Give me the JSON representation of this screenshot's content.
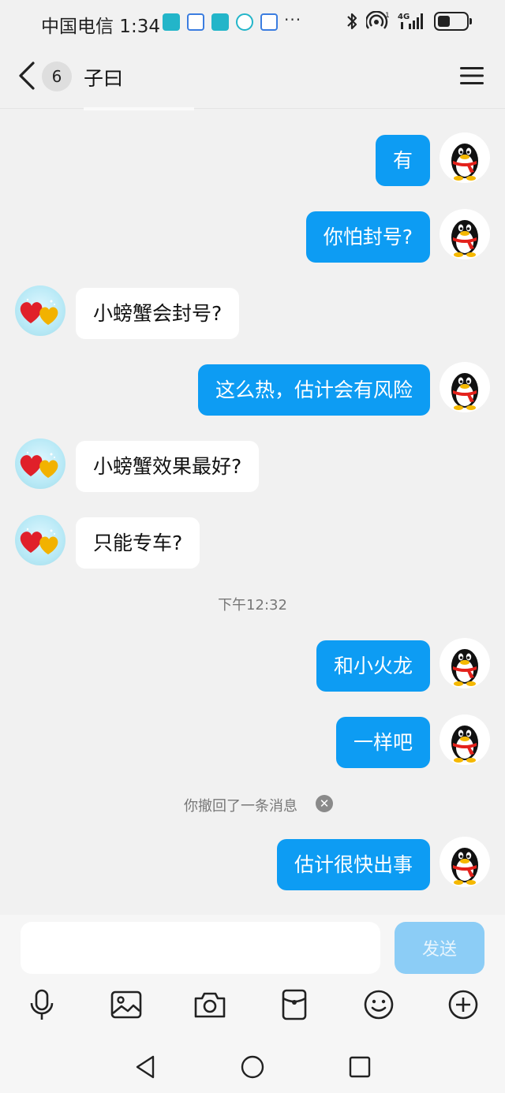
{
  "status_bar": {
    "carrier_time": "中国电信 1:34",
    "more": "···",
    "network": "4G",
    "battery_level": 0.45,
    "icons": [
      "huawei-app-icon",
      "baidu-app-icon",
      "huawei-app-icon",
      "shield-check-icon",
      "baidu-app-icon",
      "bluetooth-icon",
      "hotspot-icon",
      "signal-icon",
      "battery-icon"
    ]
  },
  "header": {
    "back_icon": "chevron-left-icon",
    "unread_count": "6",
    "title": "子曰",
    "menu_icon": "hamburger-menu-icon"
  },
  "messages": [
    {
      "side": "out",
      "text": "有"
    },
    {
      "side": "out",
      "text": "你怕封号?"
    },
    {
      "side": "in",
      "text": "小螃蟹会封号?"
    },
    {
      "side": "out",
      "text": "这么热，估计会有风险"
    },
    {
      "side": "in",
      "text": "小螃蟹效果最好?"
    },
    {
      "side": "in",
      "text": "只能专车?"
    },
    {
      "type": "time",
      "text": "下午12:32"
    },
    {
      "side": "out",
      "text": "和小火龙"
    },
    {
      "side": "out",
      "text": "一样吧"
    },
    {
      "type": "system",
      "text": "你撤回了一条消息",
      "icon": "close-icon"
    },
    {
      "side": "out",
      "text": "估计很快出事"
    }
  ],
  "avatars": {
    "self": "qq-penguin-avatar",
    "other": "hearts-avatar"
  },
  "input": {
    "value": "",
    "placeholder": "",
    "send_label": "发送"
  },
  "toolbar": [
    "microphone-icon",
    "image-icon",
    "camera-icon",
    "red-packet-icon",
    "emoji-icon",
    "plus-icon"
  ],
  "navbar": [
    "back-triangle-icon",
    "home-circle-icon",
    "recents-square-icon"
  ],
  "colors": {
    "bubble_out": "#0d9cf3",
    "bubble_in": "#ffffff",
    "background": "#f1f1f1",
    "send_disabled": "#8ccdf6"
  }
}
